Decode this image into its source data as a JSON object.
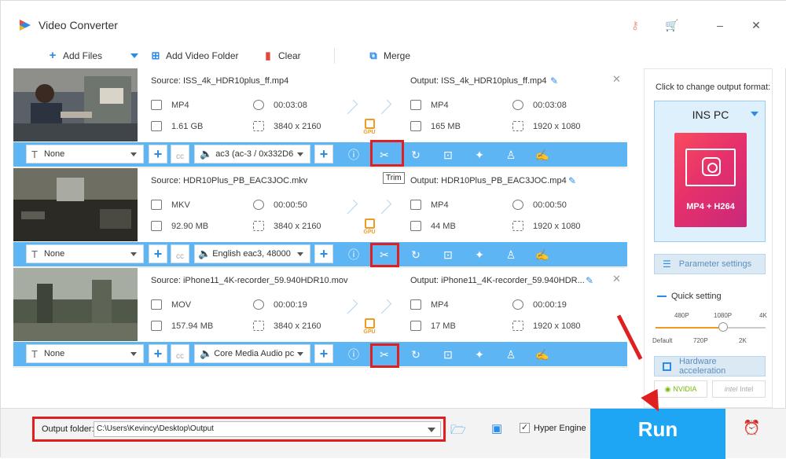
{
  "app": {
    "title": "Video Converter"
  },
  "toolbar": {
    "add_files": "Add Files",
    "add_video_folder": "Add Video Folder",
    "clear": "Clear",
    "merge": "Merge"
  },
  "items": [
    {
      "source_label": "Source: ISS_4k_HDR10plus_ff.mp4",
      "output_label": "Output: ISS_4k_HDR10plus_ff.mp4",
      "src_format": "MP4",
      "src_duration": "00:03:08",
      "src_size": "1.61 GB",
      "src_resolution": "3840 x 2160",
      "out_format": "MP4",
      "out_duration": "00:03:08",
      "out_size": "165 MB",
      "out_resolution": "1920 x 1080",
      "subtitle": "None",
      "audio": "ac3 (ac-3 / 0x332D6"
    },
    {
      "source_label": "Source: HDR10Plus_PB_EAC3JOC.mkv",
      "output_label": "Output: HDR10Plus_PB_EAC3JOC.mp4",
      "src_format": "MKV",
      "src_duration": "00:00:50",
      "src_size": "92.90 MB",
      "src_resolution": "3840 x 2160",
      "out_format": "MP4",
      "out_duration": "00:00:50",
      "out_size": "44 MB",
      "out_resolution": "1920 x 1080",
      "subtitle": "None",
      "audio": "English eac3, 48000"
    },
    {
      "source_label": "Source: iPhone11_4K-recorder_59.940HDR10.mov",
      "output_label": "Output: iPhone11_4K-recorder_59.940HDR...",
      "src_format": "MOV",
      "src_duration": "00:00:19",
      "src_size": "157.94 MB",
      "src_resolution": "3840 x 2160",
      "out_format": "MP4",
      "out_duration": "00:00:19",
      "out_size": "17 MB",
      "out_resolution": "1920 x 1080",
      "subtitle": "None",
      "audio": "Core Media Audio pc"
    }
  ],
  "gpu_label": "GPU",
  "tooltip": "Trim",
  "sidebar": {
    "hint": "Click to change output format:",
    "format_name": "INS PC",
    "format_badge": "MP4 + H264",
    "parameter_settings": "Parameter settings",
    "quick_setting": "Quick setting",
    "quality_top": [
      "480P",
      "1080P",
      "4K"
    ],
    "quality_bottom": [
      "Default",
      "720P",
      "2K"
    ],
    "quality_level": 0.62,
    "hardware_acceleration": "Hardware acceleration",
    "nvidia": "NVIDIA",
    "intel": "Intel"
  },
  "bottom": {
    "output_folder_label": "Output folder:",
    "output_folder_value": "C:\\Users\\Kevincy\\Desktop\\Output",
    "hyper_engine": "Hyper Engine",
    "hyper_engine_checked": true,
    "run": "Run"
  },
  "colors": {
    "accent": "#5eb5f4",
    "run": "#1ea6f4",
    "highlight": "#e02020",
    "gpu": "#f09a1f"
  }
}
